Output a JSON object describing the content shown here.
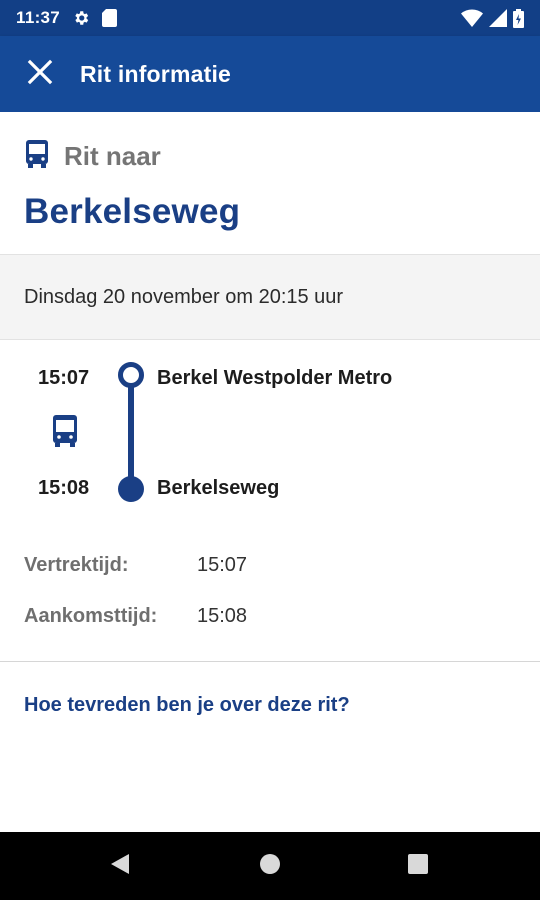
{
  "status_bar": {
    "time": "11:37"
  },
  "app_bar": {
    "title": "Rit informatie"
  },
  "trip": {
    "heading": "Rit naar",
    "destination": "Berkelseweg",
    "date": "Dinsdag 20 november om 20:15 uur"
  },
  "timeline": {
    "departure": {
      "time": "15:07",
      "stop": "Berkel Westpolder Metro"
    },
    "arrival": {
      "time": "15:08",
      "stop": "Berkelseweg"
    }
  },
  "details": {
    "departure_label": "Vertrektijd:",
    "departure_value": "15:07",
    "arrival_label": "Aankomsttijd:",
    "arrival_value": "15:08"
  },
  "feedback": {
    "label": "Hoe tevreden ben je over deze rit?"
  },
  "icons": {
    "close": "close-icon",
    "bus": "bus-icon",
    "settings": "gear-icon",
    "sd_card": "sd-card-icon",
    "wifi": "wifi-icon",
    "signal": "signal-icon",
    "battery": "battery-icon",
    "back": "back-icon",
    "home": "home-icon",
    "recents": "recents-icon"
  },
  "colors": {
    "primary_dark": "#123f86",
    "primary": "#154a98",
    "accent_text": "#1a3f85",
    "muted": "#757575"
  }
}
